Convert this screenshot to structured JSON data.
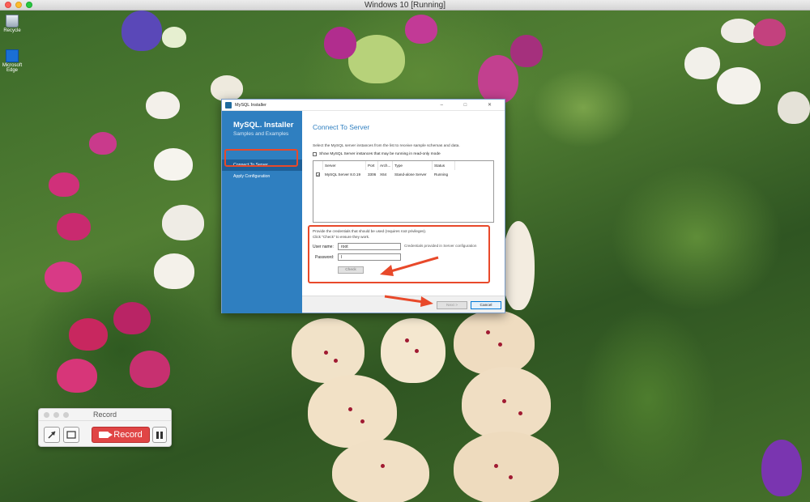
{
  "host_window": {
    "title": "Windows 10 [Running]"
  },
  "desktop": {
    "icons": [
      {
        "label": "Recycle",
        "icon": "recycle-bin-icon"
      },
      {
        "label": "Microsoft Edge",
        "icon": "edge-icon"
      }
    ]
  },
  "installer": {
    "title": "MySQL Installer",
    "window_controls": "–  □  ✕",
    "logo": {
      "main": "MySQL. Installer",
      "sub": "Samples and Examples"
    },
    "nav": [
      {
        "label": "Connect To Server",
        "active": true
      },
      {
        "label": "Apply Configuration",
        "active": false
      }
    ],
    "heading": "Connect To Server",
    "description": "Select the MySQL server instances from the list to receive sample schemas and data.",
    "show_readonly_label": "Show MySQL Server instances that may be running in read-only mode",
    "table": {
      "headers": [
        "",
        "Server",
        "Port",
        "Arch...",
        "Type",
        "Status"
      ],
      "rows": [
        {
          "checked": true,
          "server": "MySQL Server 8.0.19",
          "port": "3306",
          "arch": "X64",
          "type": "Stand-alone Server",
          "status": "Running"
        }
      ]
    },
    "credentials_hint_line1": "Provide the credentials that should be used (requires root privileges).",
    "credentials_hint_line2": "Click \"Check\" to ensure they work.",
    "username_label": "User name:",
    "username_value": "root",
    "password_label": "Password:",
    "password_value": "I",
    "credentials_note": "Credentials provided in Server configuration",
    "check_button": "Check",
    "next_button": "Next >",
    "cancel_button": "Cancel"
  },
  "recorder": {
    "title": "Record",
    "record_label": "Record"
  },
  "colors": {
    "accent_blue": "#2f7fc0",
    "annotation_red": "#e8492a",
    "record_red": "#e04545"
  }
}
